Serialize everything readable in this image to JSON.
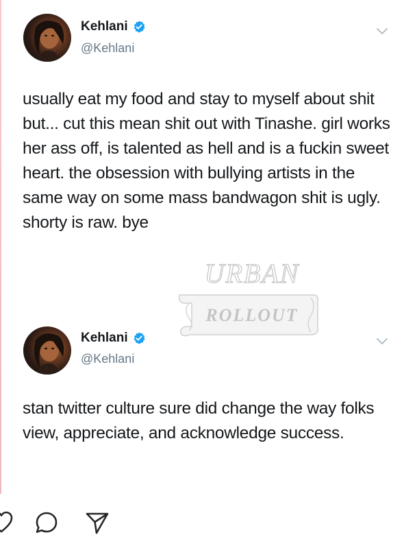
{
  "tweets": [
    {
      "display_name": "Kehlani",
      "handle": "@Kehlani",
      "verified": true,
      "text": "usually eat my food and stay to myself about shit but... cut this mean shit out with Tinashe. girl works her ass off, is talented as hell and is a fuckin sweet heart. the obsession with bullying artists in the same way on some mass bandwagon shit is ugly. shorty is raw. bye"
    },
    {
      "display_name": "Kehlani",
      "handle": "@Kehlani",
      "verified": true,
      "text": "stan twitter culture sure did change the way folks view, appreciate, and acknowledge success."
    }
  ],
  "watermark": {
    "line1": "URBAN",
    "line2": "ROLLOUT"
  },
  "action_bar": {
    "icons": [
      "comment-icon",
      "share-icon"
    ]
  },
  "colors": {
    "text": "#14171a",
    "secondary": "#657786",
    "verified": "#1da1f2"
  }
}
